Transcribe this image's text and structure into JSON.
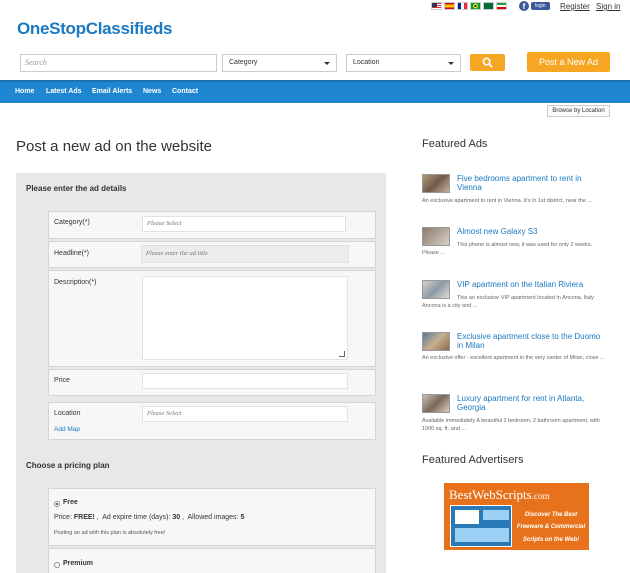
{
  "header": {
    "logo": "OneStopClassifieds",
    "flags": [
      "us-flag",
      "es-flag",
      "fr-flag",
      "br-flag",
      "sa-flag",
      "ir-flag"
    ],
    "fb_login": "login",
    "register": "Register",
    "signin": "Sign in"
  },
  "search": {
    "placeholder": "Search",
    "category": "Category",
    "location": "Location",
    "post_ad": "Post a New Ad"
  },
  "nav": [
    "Home",
    "Latest Ads",
    "Email Alerts",
    "News",
    "Contact"
  ],
  "browse_location": "Browse by Location",
  "main": {
    "title": "Post a new ad on the website",
    "details_title": "Please enter the ad details",
    "fields": {
      "category_label": "Category(*)",
      "category_value": "Please Select",
      "headline_label": "Headline(*)",
      "headline_placeholder": "Please enter the ad title",
      "description_label": "Description(*)",
      "price_label": "Price",
      "location_label": "Location",
      "location_value": "Please Select",
      "add_map": "Add Map"
    },
    "pricing_title": "Choose a pricing plan",
    "plans": [
      {
        "name": "Free",
        "price_label": "Price:",
        "price": "FREE!",
        "expire_label": "Ad expire time (days):",
        "expire": "30",
        "images_label": "Allowed images:",
        "images": "5",
        "note": "Posting an ad with this plan is absolutely free!"
      },
      {
        "name": "Premium"
      }
    ]
  },
  "featured": {
    "title": "Featured Ads",
    "items": [
      {
        "title": "Five bedrooms apartment to rent in Vienna",
        "desc": "An exclusive apartment to rent in Vienna. It's in 1st district, near the ..."
      },
      {
        "title": "Almost new Galaxy S3",
        "desc": "This phone is almost new, it was used for only 2 weeks. Please ..."
      },
      {
        "title": "VIP apartment on the Italian Riviera",
        "desc": "This an exclusive VIP apartment located in Ancona, Italy Ancona is a city and ..."
      },
      {
        "title": "Exclusive apartment close to the Duomo in Milan",
        "desc": "An exclusive offer - excellent apartment in the very center of Milan, close ..."
      },
      {
        "title": "Luxury apartment for rent in Atlanta, Georgia",
        "desc": "Available immediately A beautiful 2 bedroom, 2 bathroom apartment, with 1000 sq. ft. and ..."
      }
    ]
  },
  "advertisers": {
    "title": "Featured Advertisers",
    "banner_main": "BestWebScripts",
    "banner_domain": ".com",
    "banner_l1": "Discover The Best",
    "banner_l2": "Freeware & Commercial",
    "banner_l3": "Scripts on the Web!"
  },
  "colors": {
    "brand": "#1a7ac2",
    "nav": "#1f86d2",
    "accent": "#f6a623",
    "banner": "#e8721c"
  }
}
